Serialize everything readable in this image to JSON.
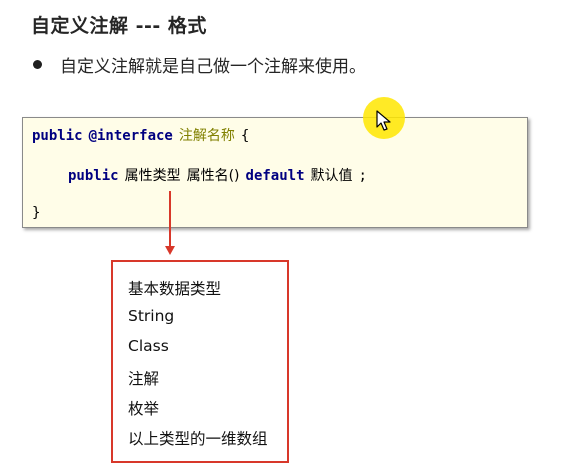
{
  "slide": {
    "title": "自定义注解 --- 格式",
    "bullet": "自定义注解就是自己做一个注解来使用。"
  },
  "code": {
    "line1": {
      "keyword": "public",
      "annotation_keyword": "@interface",
      "name": "注解名称",
      "brace": "{"
    },
    "line2": {
      "keyword": "public",
      "attr_type": "属性类型",
      "attr_name": "属性名()",
      "default_keyword": "default",
      "default_value": "默认值",
      "terminator": ";"
    },
    "line3": {
      "brace": "}"
    }
  },
  "attribute_types": [
    "基本数据类型",
    "String",
    "Class",
    "注解",
    "枚举",
    "以上类型的一维数组"
  ],
  "colors": {
    "keyword": "#000080",
    "annotation_name": "#808000",
    "highlight_border": "#d8382a",
    "code_background": "#fffde8",
    "cursor_halo": "#ffe600"
  }
}
